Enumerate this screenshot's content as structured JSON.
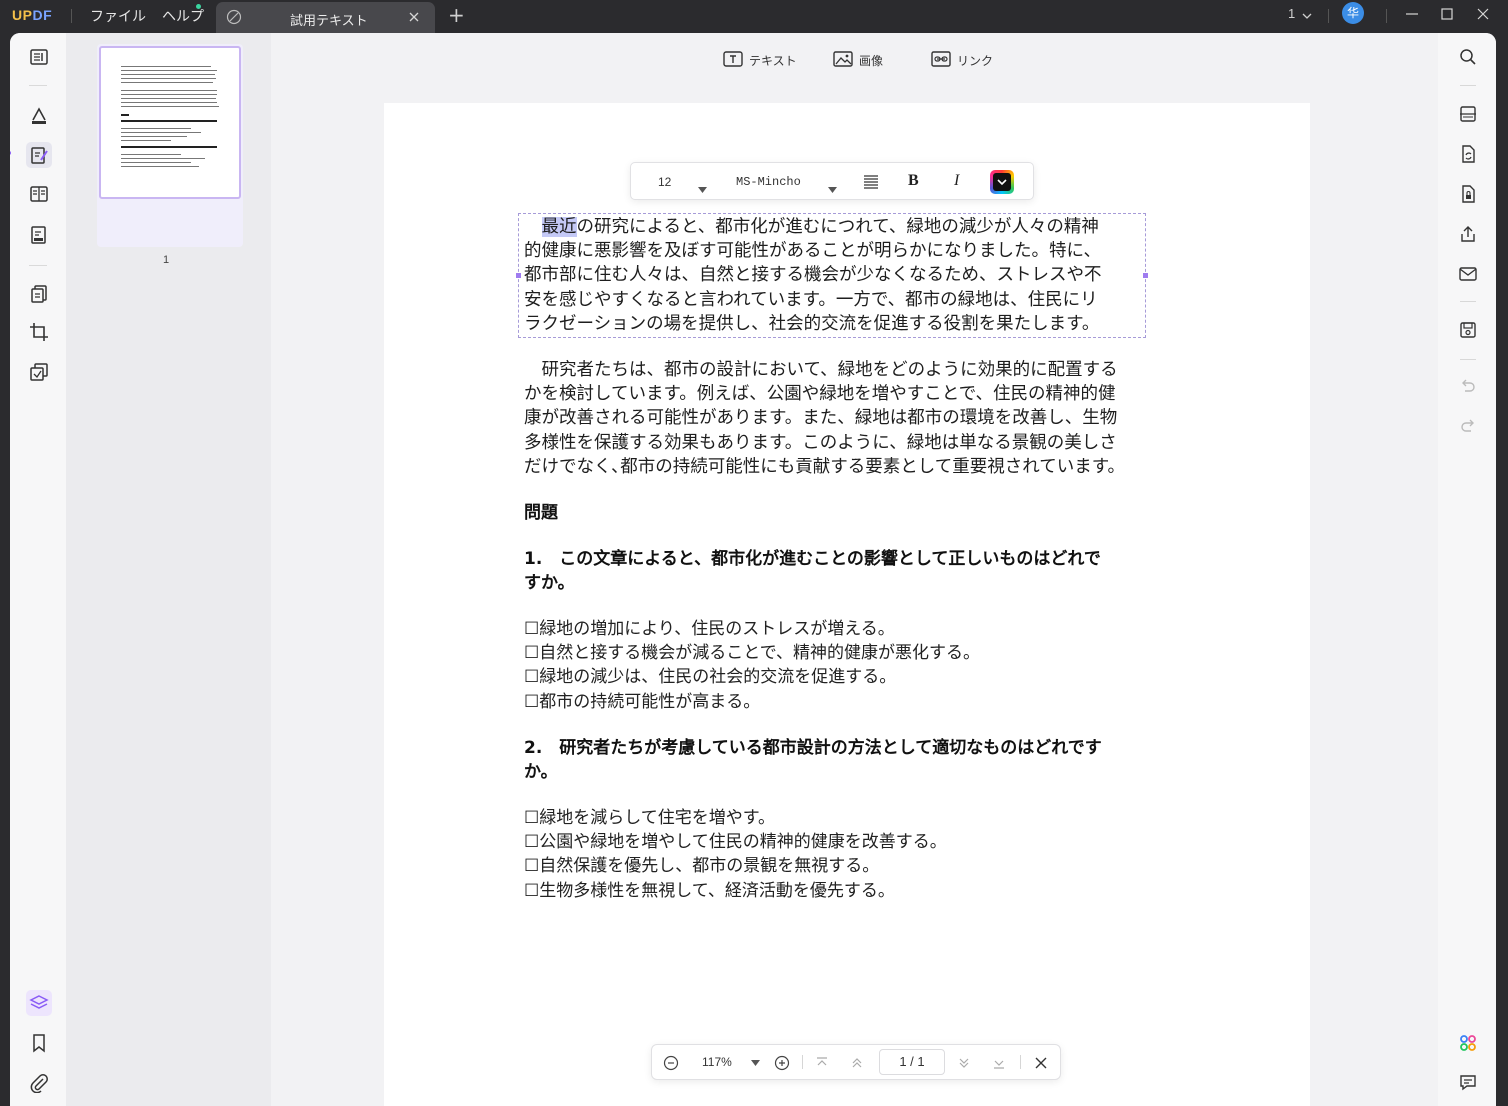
{
  "app": {
    "logo_up": "UP",
    "logo_df": "DF",
    "menu": [
      "ファイル",
      "ヘルプ"
    ],
    "tab_title": "試用テキスト",
    "tab_add": "+",
    "window_count": "1",
    "avatar_initial": "华"
  },
  "edit_toolbar": {
    "text_label": "テキスト",
    "image_label": "画像",
    "link_label": "リンク"
  },
  "format_toolbar": {
    "font_size": "12",
    "font_name": "MS-Mincho",
    "bold_label": "B",
    "italic_label": "I"
  },
  "document": {
    "para1_selected": "最近",
    "para1_line1_rest": "の研究によると、都市化が進むにつれて、緑地の減少が人々の精神",
    "para1_lines": [
      "的健康に悪影響を及ぼす可能性があることが明らかになりました。特に、",
      "都市部に住む人々は、自然と接する機会が少なくなるため、ストレスや不",
      "安を感じやすくなると言われています。一方で、都市の緑地は、住民にリ",
      "ラクゼーションの場を提供し、社会的交流を促進する役割を果たします。"
    ],
    "para2_lines": [
      "　研究者たちは、都市の設計において、緑地をどのように効果的に配置する",
      "かを検討しています。例えば、公園や緑地を増やすことで、住民の精神的健",
      "康が改善される可能性があります。また、緑地は都市の環境を改善し、生物",
      "多様性を保護する効果もあります。このように、緑地は単なる景観の美しさ",
      "だけでなく､都市の持続可能性にも貢献する要素として重要視されています。"
    ],
    "heading": "問題",
    "q1_lines": [
      "1.　この文章によると、都市化が進むことの影響として正しいものはどれで",
      "すか。"
    ],
    "q1_options": [
      "☐緑地の増加により、住民のストレスが増える。",
      "☐自然と接する機会が減ることで、精神的健康が悪化する。",
      "☐緑地の減少は、住民の社会的交流を促進する。",
      "☐都市の持続可能性が高まる。"
    ],
    "q2_lines": [
      "2.　研究者たちが考慮している都市設計の方法として適切なものはどれです",
      "か。"
    ],
    "q2_options": [
      "☐緑地を減らして住宅を増やす。",
      "☐公園や緑地を増やして住民の精神的健康を改善する。",
      "☐自然保護を優先し、都市の景観を無視する。",
      "☐生物多様性を無視して、経済活動を優先する。"
    ]
  },
  "thumbnail": {
    "page_number": "1"
  },
  "bottom_nav": {
    "zoom": "117%",
    "page_indicator": "1 / 1"
  },
  "colors": {
    "accent": "#8a5cf6",
    "selection": "#c4c9f6",
    "titlebar": "#2b2b2e"
  }
}
